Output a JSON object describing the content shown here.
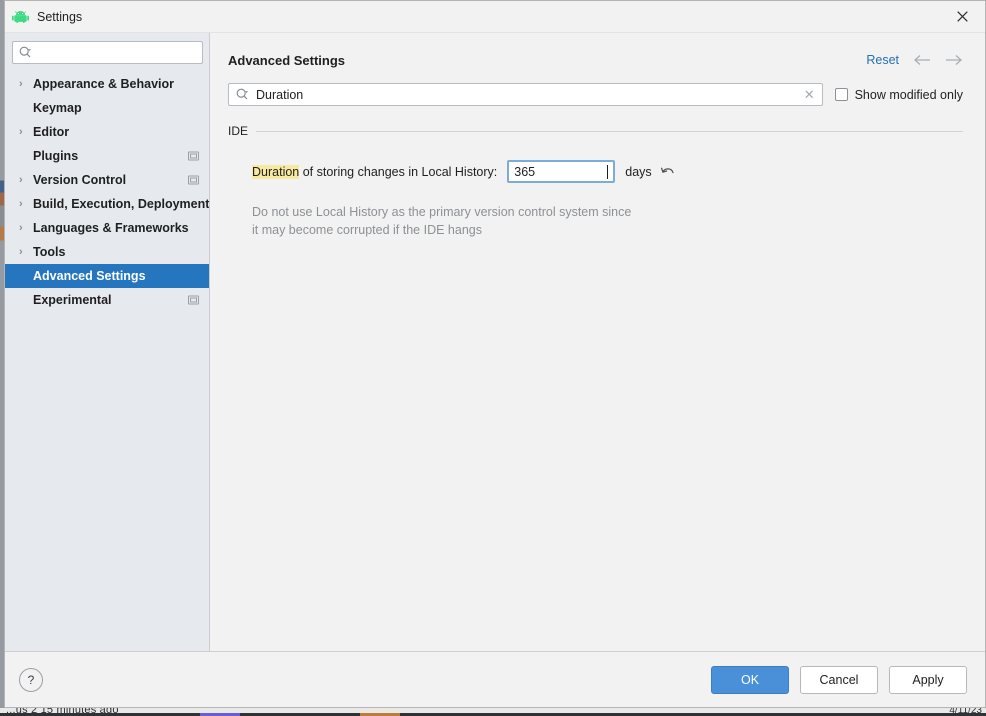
{
  "window": {
    "title": "Settings",
    "app_icon": "android-logo-icon",
    "close_icon": "close-icon"
  },
  "sidebar": {
    "search": {
      "value": "",
      "placeholder": "",
      "icon": "search-icon"
    },
    "items": [
      {
        "label": "Appearance & Behavior",
        "expandable": true,
        "badge": false,
        "selected": false
      },
      {
        "label": "Keymap",
        "expandable": false,
        "badge": false,
        "selected": false
      },
      {
        "label": "Editor",
        "expandable": true,
        "badge": false,
        "selected": false
      },
      {
        "label": "Plugins",
        "expandable": false,
        "badge": true,
        "selected": false
      },
      {
        "label": "Version Control",
        "expandable": true,
        "badge": true,
        "selected": false
      },
      {
        "label": "Build, Execution, Deployment",
        "expandable": true,
        "badge": false,
        "selected": false
      },
      {
        "label": "Languages & Frameworks",
        "expandable": true,
        "badge": false,
        "selected": false
      },
      {
        "label": "Tools",
        "expandable": true,
        "badge": false,
        "selected": false
      },
      {
        "label": "Advanced Settings",
        "expandable": false,
        "badge": false,
        "selected": true
      },
      {
        "label": "Experimental",
        "expandable": false,
        "badge": true,
        "selected": false
      }
    ]
  },
  "main": {
    "title": "Advanced Settings",
    "reset_label": "Reset",
    "back_icon": "arrow-left-icon",
    "forward_icon": "arrow-right-icon",
    "search": {
      "value": "Duration",
      "placeholder": "",
      "icon": "search-icon",
      "clear_icon": "clear-icon"
    },
    "show_modified_only": {
      "label": "Show modified only",
      "checked": false
    },
    "group": {
      "title": "IDE",
      "setting": {
        "label_highlight": "Duration",
        "label_rest": " of storing changes in Local History:",
        "value": "365",
        "unit": "days",
        "revert_icon": "revert-icon"
      },
      "hint_line1": "Do not use Local History as the primary version control system since",
      "hint_line2": "it may become corrupted if the IDE hangs"
    }
  },
  "footer": {
    "help_label": "?",
    "ok_label": "OK",
    "cancel_label": "Cancel",
    "apply_label": "Apply"
  },
  "background": {
    "bottom_text": "...us 2 15 minutes ago",
    "bottom_right": "4/11/23"
  },
  "colors": {
    "accent_blue": "#2675bf",
    "link_blue": "#2470b3",
    "primary_button": "#4a90d9",
    "highlight_yellow": "#f7e9a0",
    "sidebar_bg": "#e6eaee",
    "panel_bg": "#f2f2f2"
  }
}
